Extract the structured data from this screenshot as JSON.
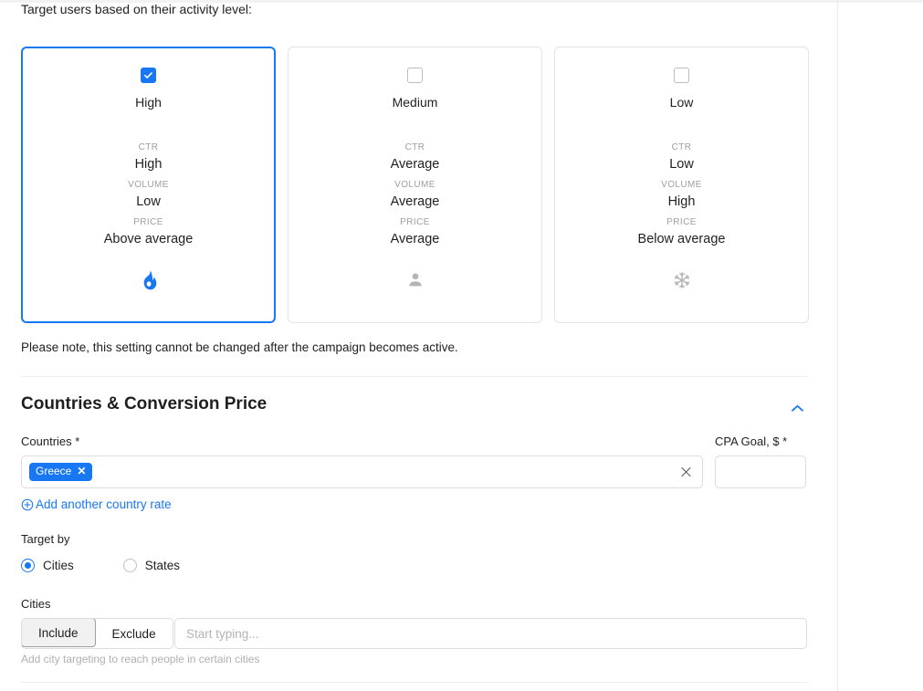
{
  "intro_text": "Target users based on their activity level:",
  "colors": {
    "accent": "#1877f2",
    "border": "#e3e3e3",
    "muted": "#9e9e9e"
  },
  "activity_cards": [
    {
      "title": "High",
      "checked": true,
      "selected": true,
      "icon": "flame-icon",
      "stats": [
        {
          "key": "CTR",
          "value": "High"
        },
        {
          "key": "VOLUME",
          "value": "Low"
        },
        {
          "key": "PRICE",
          "value": "Above average"
        }
      ]
    },
    {
      "title": "Medium",
      "checked": false,
      "selected": false,
      "icon": "person-icon",
      "stats": [
        {
          "key": "CTR",
          "value": "Average"
        },
        {
          "key": "VOLUME",
          "value": "Average"
        },
        {
          "key": "PRICE",
          "value": "Average"
        }
      ]
    },
    {
      "title": "Low",
      "checked": false,
      "selected": false,
      "icon": "snowflake-icon",
      "stats": [
        {
          "key": "CTR",
          "value": "Low"
        },
        {
          "key": "VOLUME",
          "value": "High"
        },
        {
          "key": "PRICE",
          "value": "Below average"
        }
      ]
    }
  ],
  "note_text": "Please note, this setting cannot be changed after the campaign becomes active.",
  "section": {
    "title": "Countries & Conversion Price",
    "toggle_icon": "chevron-up-icon",
    "countries": {
      "label": "Countries *",
      "tags": [
        {
          "label": "Greece",
          "remove_icon": "tag-remove-icon"
        }
      ],
      "clear_icon": "clear-icon",
      "placeholder": ""
    },
    "cpa_goal": {
      "label": "CPA Goal, $ *",
      "value": "",
      "placeholder": ""
    },
    "add_link": {
      "label": "Add another country rate",
      "icon": "plus-circle-icon"
    },
    "target_by": {
      "label": "Target by",
      "options": [
        {
          "label": "Cities",
          "selected": true
        },
        {
          "label": "States",
          "selected": false
        }
      ]
    },
    "cities": {
      "label": "Cities",
      "segments": [
        {
          "label": "Include",
          "active": true
        },
        {
          "label": "Exclude",
          "active": false
        }
      ],
      "input_value": "",
      "input_placeholder": "Start typing...",
      "hint": "Add city targeting to reach people in certain cities"
    }
  }
}
